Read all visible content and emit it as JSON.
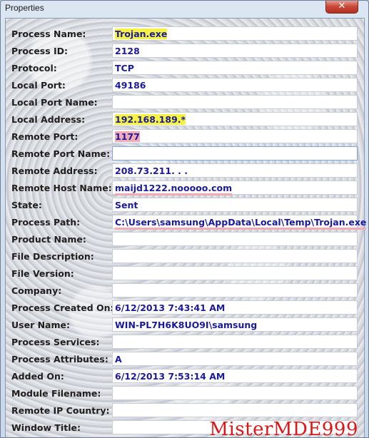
{
  "window": {
    "title": "Properties",
    "close_label": "✕"
  },
  "colors": {
    "value_text": "#1a1a9c",
    "highlight_yellow": "#f6f243",
    "highlight_pink": "#f2aab6",
    "watermark": "#e01515"
  },
  "rows": [
    {
      "label": "Process Name:",
      "value": "Trojan.exe"
    },
    {
      "label": "Process ID:",
      "value": "2128"
    },
    {
      "label": "Protocol:",
      "value": "TCP"
    },
    {
      "label": "Local Port:",
      "value": "49186"
    },
    {
      "label": "Local Port Name:",
      "value": ""
    },
    {
      "label": "Local Address:",
      "value": "192.168.189.*"
    },
    {
      "label": "Remote Port:",
      "value": "1177"
    },
    {
      "label": "Remote Port Name:",
      "value": ""
    },
    {
      "label": "Remote Address:",
      "value": "208.73.211. . ."
    },
    {
      "label": "Remote Host Name:",
      "value": "maijd1222.nooooo.com"
    },
    {
      "label": "State:",
      "value": "Sent"
    },
    {
      "label": "Process Path:",
      "value": "C:\\Users\\samsung\\AppData\\Local\\Temp\\Trojan.exe"
    },
    {
      "label": "Product Name:",
      "value": ""
    },
    {
      "label": "File Description:",
      "value": ""
    },
    {
      "label": "File Version:",
      "value": ""
    },
    {
      "label": "Company:",
      "value": ""
    },
    {
      "label": "Process Created On:",
      "value": "6/12/2013 7:43:41 AM"
    },
    {
      "label": "User Name:",
      "value": "WIN-PL7H6K8UO9I\\samsung"
    },
    {
      "label": "Process Services:",
      "value": ""
    },
    {
      "label": "Process Attributes:",
      "value": "A"
    },
    {
      "label": "Added On:",
      "value": "6/12/2013 7:53:14 AM"
    },
    {
      "label": "Module Filename:",
      "value": ""
    },
    {
      "label": "Remote IP Country:",
      "value": ""
    },
    {
      "label": "Window Title:",
      "value": ""
    }
  ],
  "watermark": "MisterMDE999"
}
